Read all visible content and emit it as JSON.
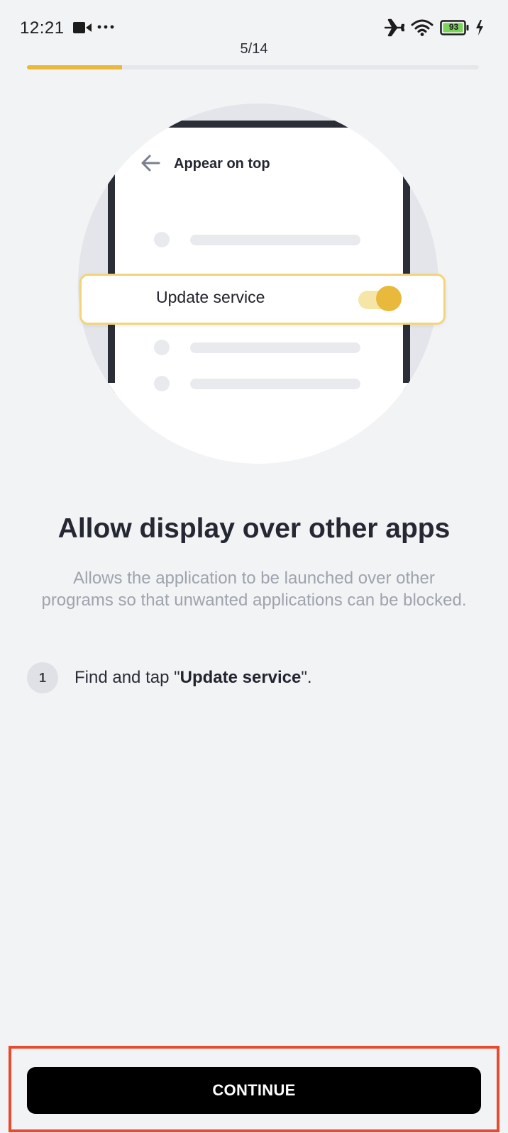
{
  "status_bar": {
    "time": "12:21",
    "battery_level": "93",
    "icons": [
      "video-camera-icon",
      "more-dots-icon",
      "airplane-icon",
      "wifi-icon",
      "battery-icon",
      "charging-icon"
    ]
  },
  "progress": {
    "label": "5/14",
    "current_step": 5,
    "total_steps": 14,
    "accent_color": "#e8b93a"
  },
  "illustration": {
    "phone_screen_title": "Appear on top",
    "back_icon": "arrow-left-icon",
    "highlighted_setting": "Update service",
    "toggle_state": "on"
  },
  "content": {
    "heading": "Allow display over other apps",
    "description": "Allows the application to be launched over other programs so that unwanted applications can be blocked.",
    "steps": [
      {
        "number": "1",
        "prefix": "Find and tap \"",
        "bold": "Update service",
        "suffix": "\"."
      }
    ]
  },
  "footer": {
    "continue_label": "CONTINUE",
    "highlight_color": "#e84a2f"
  }
}
